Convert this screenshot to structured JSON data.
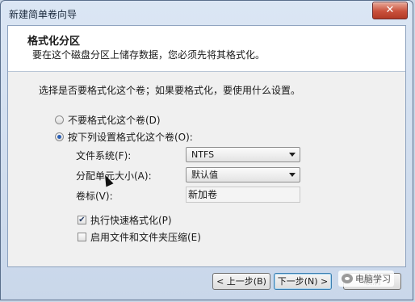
{
  "window": {
    "title": "新建简单卷向导",
    "close_label": "✕"
  },
  "header": {
    "title": "格式化分区",
    "subtitle": "要在这个磁盘分区上储存数据，您必须先将其格式化。"
  },
  "body": {
    "question": "选择是否要格式化这个卷；如果要格式化，要使用什么设置。",
    "radio_no_format": "不要格式化这个卷(D)",
    "radio_format": "按下列设置格式化这个卷(O):",
    "fs_label": "文件系统(F):",
    "fs_value": "NTFS",
    "alloc_label": "分配单元大小(A):",
    "alloc_value": "默认值",
    "volume_label": "卷标(V):",
    "volume_value": "新加卷",
    "quick_format": "执行快速格式化(P)",
    "compression": "启用文件和文件夹压缩(E)"
  },
  "footer": {
    "back": "< 上一步(B)",
    "next": "下一步(N) >",
    "cancel": "取消"
  },
  "watermark": {
    "text": "电脑学习"
  },
  "state": {
    "format_selected": true,
    "quick_format_checked": true,
    "compression_checked": false
  }
}
